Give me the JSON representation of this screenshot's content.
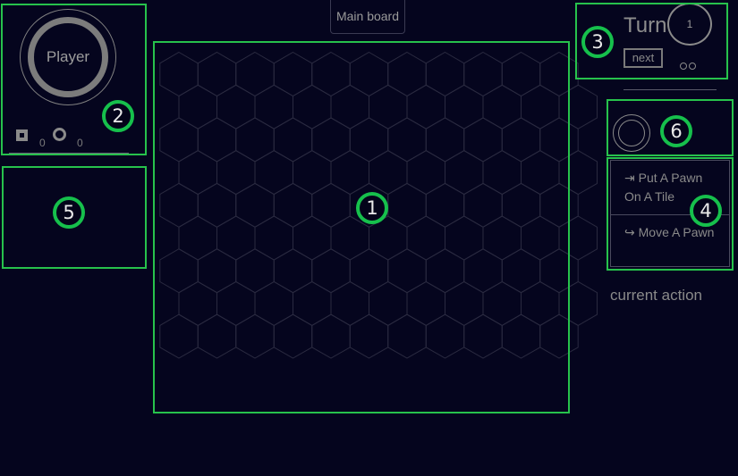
{
  "header": {
    "main_board_label": "Main board"
  },
  "player_panel": {
    "player_label": "Player",
    "stat_square_value": "0",
    "stat_circle_value": "0"
  },
  "turn_panel": {
    "title": "Turn",
    "turn_number": "1",
    "next_label": "next"
  },
  "actions": {
    "items": [
      {
        "icon": "sign-in-icon",
        "label": "Put A Pawn On A Tile"
      },
      {
        "icon": "share-icon",
        "label": "Move A Pawn"
      }
    ],
    "current_action_label": "current action"
  },
  "markers": [
    "1",
    "2",
    "3",
    "4",
    "5",
    "6"
  ],
  "colors": {
    "background": "#05051e",
    "highlight": "#27c24c",
    "hex_stroke": "#2a2a40",
    "text": "#8a8a8a"
  },
  "board": {
    "rows": 9,
    "cols": 11,
    "shape": "hexagonal grid"
  }
}
